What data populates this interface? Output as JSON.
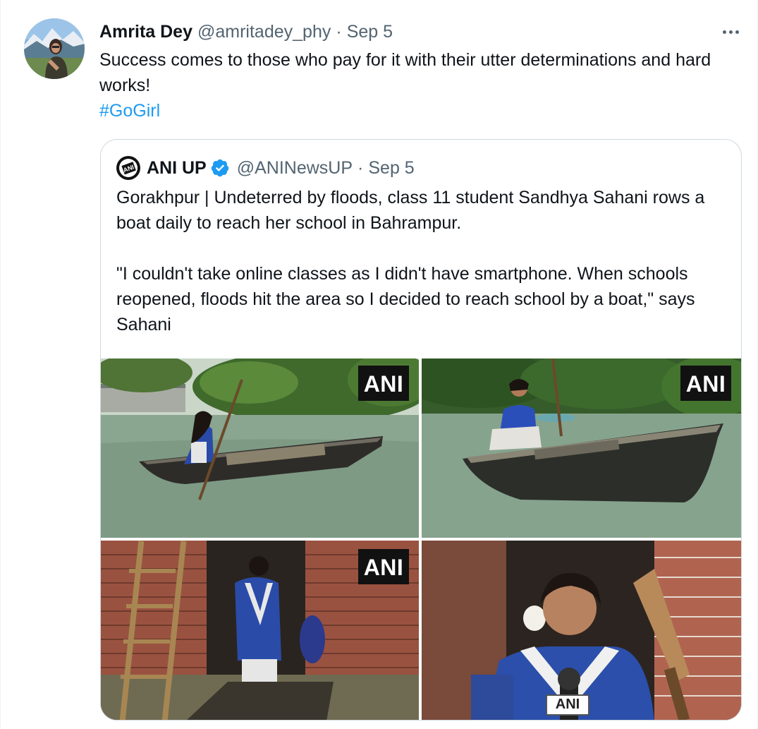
{
  "tweet": {
    "author_name": "Amrita Dey",
    "author_handle": "@amritadey_phy",
    "separator": "·",
    "date": "Sep 5",
    "text": "Success comes to those who pay for it with their utter determinations and hard works!",
    "hashtag": "#GoGirl",
    "more_icon": "more-horizontal-icon"
  },
  "quote": {
    "author_name": "ANI UP",
    "author_handle": "@ANINewsUP",
    "separator": "·",
    "date": "Sep 5",
    "verified_icon": "verified-badge-icon",
    "paragraph_1": "Gorakhpur | Undeterred by floods, class 11 student Sandhya Sahani rows a boat daily to reach her school in Bahrampur.",
    "paragraph_2": "\"I couldn't take online classes as I didn't have smartphone. When schools reopened, floods hit the area so I decided to reach school by a boat,\" says Sahani",
    "logo_text": "ANI"
  },
  "media": {
    "watermark": "ANI",
    "mic_label": "ANI",
    "photos": [
      {
        "id": "boat-side-view"
      },
      {
        "id": "boat-front-view"
      },
      {
        "id": "loading-boat-at-house"
      },
      {
        "id": "student-interview"
      }
    ]
  },
  "colors": {
    "text_primary": "#0f1419",
    "text_secondary": "#536471",
    "link": "#1d9bf0",
    "border": "#cfd9de",
    "verified": "#1d9bf0"
  }
}
